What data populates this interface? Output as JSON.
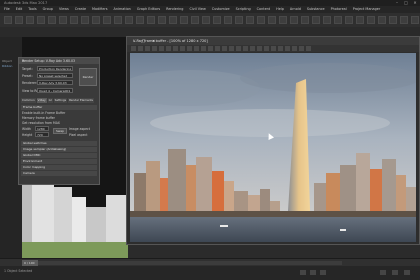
{
  "app": {
    "title": "Autodesk 3ds Max 2017",
    "window_controls": [
      "–",
      "□",
      "✕"
    ]
  },
  "menu": [
    "File",
    "Edit",
    "Tools",
    "Group",
    "Views",
    "Create",
    "Modifiers",
    "Animation",
    "Graph Editors",
    "Rendering",
    "Civil View",
    "Customize",
    "Scripting",
    "Content",
    "Help",
    "Arnold",
    "Substance",
    "Photoreal",
    "Project Manager"
  ],
  "left_panel": {
    "label1": "Object",
    "label2": "Ribbon"
  },
  "render_dialog": {
    "title": "Render Setup: V-Ray Adv 3.60.03",
    "target_label": "Target:",
    "target_value": "Production Rendering Mode",
    "preset_label": "Preset:",
    "preset_value": "No preset selected",
    "renderer_label": "Renderer:",
    "renderer_value": "V-Ray Adv 3.60.03",
    "view_label": "View to Render:",
    "view_value": "Quad 4 - Camera001",
    "render_button": "Render",
    "tabs": [
      "Common",
      "V-Ray",
      "GI",
      "Settings",
      "Render Elements"
    ],
    "active_tab": "V-Ray",
    "sections": [
      "Frame buffer",
      "Global switches",
      "Image sampler (Antialiasing)",
      "Global DMC",
      "Environment",
      "Color mapping",
      "Camera"
    ],
    "rows": [
      {
        "label": "Enable built-in Frame Buffer"
      },
      {
        "label": "Memory frame buffer"
      },
      {
        "label": "Get resolution from MAX"
      }
    ],
    "width_label": "Width",
    "width_value": "1280",
    "height_label": "Height",
    "height_value": "720",
    "swap_button": "Swap",
    "aspect_label": "Image aspect",
    "aspect_value": "1.778",
    "pixel_aspect_label": "Pixel aspect",
    "pixel_aspect_value": "1.0"
  },
  "frame_buffer": {
    "title": "V-Ray frame buffer - [100% of 1280 x 720]",
    "window_controls": "– □ ✕"
  },
  "timeline": {
    "counter": "0 / 100"
  },
  "status": {
    "text": "1 Object Selected"
  },
  "colors": {
    "sky_top": "#7e8fa3",
    "sky_bottom": "#c9cdd3",
    "tower": "#d9b27a",
    "water": "#4c5663"
  }
}
